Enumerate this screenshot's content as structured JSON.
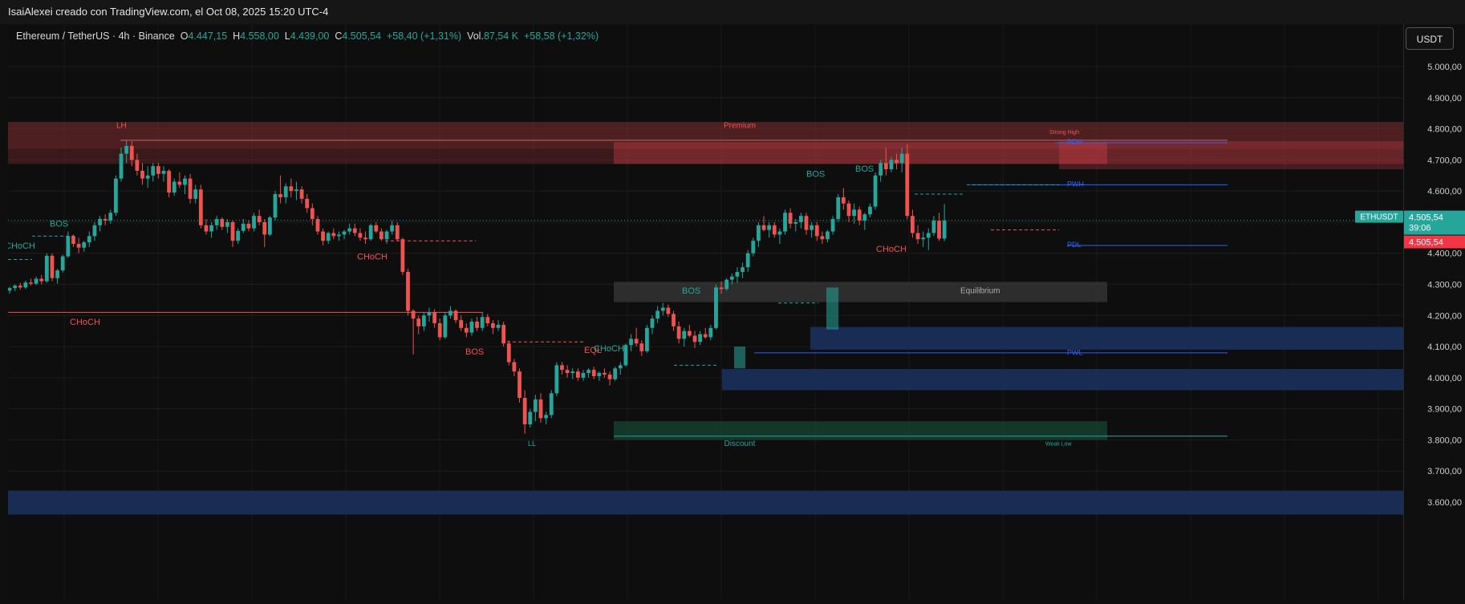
{
  "header": {
    "title": "IsaiAlexei creado con TradingView.com, el Oct 08, 2025 15:20 UTC-4"
  },
  "legend": {
    "symbol": "Ethereum / TetherUS · 4h · Binance",
    "o_label": "O",
    "o_value": "4.447,15",
    "h_label": "H",
    "h_value": "4.558,00",
    "l_label": "L",
    "l_value": "4.439,00",
    "c_label": "C",
    "c_value": "4.505,54",
    "change": "+58,40 (+1,31%)",
    "vol_label": "Vol.",
    "vol_value": "87,54 K",
    "vol_change": "+58,58 (+1,32%)"
  },
  "currency_button": "USDT",
  "last_price": {
    "ticker": "ETHUSDT",
    "price": "4.505,54",
    "countdown": "39:06",
    "price_red": "4.505,54"
  },
  "colors": {
    "up": "#26a69a",
    "down": "#ef5350",
    "premium_zone": "#5c2426",
    "discount_zone": "#10352a",
    "equilibrium_zone": "#2b2b2b",
    "blue_zone": "#16264a",
    "blue_line": "#2962ff"
  },
  "chart_data": {
    "type": "candlestick",
    "symbol": "ETHUSDT",
    "timeframe": "4h",
    "y_axis": {
      "ticks": [
        5000,
        4900,
        4800,
        4700,
        4600,
        4500,
        4400,
        4300,
        4200,
        4100,
        4000,
        3900,
        3800,
        3700,
        3600
      ],
      "tick_labels": [
        "5.000,00",
        "4.900,00",
        "4.800,00",
        "4.700,00",
        "4.600,00",
        "4.500,00",
        "4.400,00",
        "4.300,00",
        "4.200,00",
        "4.100,00",
        "4.000,00",
        "3.900,00",
        "3.800,00",
        "3.700,00",
        "3.600,00"
      ],
      "range": [
        3575,
        5080
      ]
    },
    "candles": [
      [
        4280,
        4292,
        4270,
        4288
      ],
      [
        4288,
        4300,
        4278,
        4296
      ],
      [
        4296,
        4305,
        4283,
        4290
      ],
      [
        4290,
        4312,
        4285,
        4306
      ],
      [
        4306,
        4318,
        4296,
        4302
      ],
      [
        4302,
        4325,
        4298,
        4318
      ],
      [
        4318,
        4330,
        4300,
        4310
      ],
      [
        4310,
        4400,
        4305,
        4392
      ],
      [
        4392,
        4400,
        4310,
        4320
      ],
      [
        4320,
        4350,
        4302,
        4345
      ],
      [
        4345,
        4395,
        4338,
        4390
      ],
      [
        4390,
        4470,
        4385,
        4455
      ],
      [
        4455,
        4460,
        4420,
        4430
      ],
      [
        4430,
        4450,
        4400,
        4418
      ],
      [
        4418,
        4440,
        4405,
        4435
      ],
      [
        4435,
        4470,
        4420,
        4455
      ],
      [
        4455,
        4500,
        4440,
        4490
      ],
      [
        4490,
        4520,
        4470,
        4510
      ],
      [
        4510,
        4525,
        4490,
        4505
      ],
      [
        4505,
        4540,
        4495,
        4530
      ],
      [
        4530,
        4650,
        4520,
        4640
      ],
      [
        4640,
        4740,
        4630,
        4720
      ],
      [
        4720,
        4763,
        4690,
        4745
      ],
      [
        4745,
        4760,
        4680,
        4700
      ],
      [
        4700,
        4720,
        4650,
        4665
      ],
      [
        4665,
        4690,
        4620,
        4640
      ],
      [
        4640,
        4680,
        4610,
        4650
      ],
      [
        4650,
        4690,
        4630,
        4680
      ],
      [
        4680,
        4690,
        4640,
        4655
      ],
      [
        4655,
        4680,
        4630,
        4665
      ],
      [
        4665,
        4670,
        4580,
        4595
      ],
      [
        4595,
        4640,
        4585,
        4630
      ],
      [
        4630,
        4660,
        4610,
        4620
      ],
      [
        4620,
        4650,
        4590,
        4640
      ],
      [
        4640,
        4655,
        4560,
        4575
      ],
      [
        4575,
        4620,
        4560,
        4605
      ],
      [
        4605,
        4620,
        4480,
        4490
      ],
      [
        4490,
        4510,
        4460,
        4470
      ],
      [
        4470,
        4500,
        4450,
        4490
      ],
      [
        4490,
        4520,
        4475,
        4510
      ],
      [
        4510,
        4515,
        4475,
        4485
      ],
      [
        4485,
        4510,
        4465,
        4500
      ],
      [
        4500,
        4505,
        4420,
        4440
      ],
      [
        4440,
        4480,
        4430,
        4472
      ],
      [
        4472,
        4510,
        4465,
        4495
      ],
      [
        4495,
        4505,
        4470,
        4480
      ],
      [
        4480,
        4530,
        4470,
        4520
      ],
      [
        4520,
        4540,
        4490,
        4500
      ],
      [
        4500,
        4510,
        4420,
        4460
      ],
      [
        4460,
        4520,
        4455,
        4515
      ],
      [
        4515,
        4600,
        4505,
        4590
      ],
      [
        4590,
        4650,
        4560,
        4580
      ],
      [
        4580,
        4625,
        4560,
        4615
      ],
      [
        4615,
        4640,
        4580,
        4600
      ],
      [
        4600,
        4630,
        4570,
        4605
      ],
      [
        4605,
        4615,
        4560,
        4575
      ],
      [
        4575,
        4590,
        4530,
        4545
      ],
      [
        4545,
        4560,
        4490,
        4510
      ],
      [
        4510,
        4520,
        4460,
        4470
      ],
      [
        4470,
        4480,
        4425,
        4440
      ],
      [
        4440,
        4470,
        4430,
        4465
      ],
      [
        4465,
        4480,
        4445,
        4455
      ],
      [
        4455,
        4470,
        4440,
        4460
      ],
      [
        4460,
        4475,
        4445,
        4470
      ],
      [
        4470,
        4495,
        4460,
        4480
      ],
      [
        4480,
        4495,
        4455,
        4465
      ],
      [
        4465,
        4480,
        4440,
        4450
      ],
      [
        4450,
        4470,
        4430,
        4445
      ],
      [
        4445,
        4495,
        4440,
        4490
      ],
      [
        4490,
        4500,
        4465,
        4470
      ],
      [
        4470,
        4480,
        4440,
        4445
      ],
      [
        4445,
        4475,
        4430,
        4470
      ],
      [
        4470,
        4505,
        4460,
        4490
      ],
      [
        4490,
        4500,
        4440,
        4445
      ],
      [
        4445,
        4450,
        4330,
        4340
      ],
      [
        4340,
        4350,
        4200,
        4215
      ],
      [
        4215,
        4220,
        4075,
        4190
      ],
      [
        4190,
        4200,
        4140,
        4165
      ],
      [
        4165,
        4210,
        4150,
        4200
      ],
      [
        4200,
        4225,
        4180,
        4210
      ],
      [
        4210,
        4220,
        4160,
        4175
      ],
      [
        4175,
        4190,
        4120,
        4130
      ],
      [
        4130,
        4210,
        4125,
        4200
      ],
      [
        4200,
        4230,
        4190,
        4215
      ],
      [
        4215,
        4220,
        4175,
        4185
      ],
      [
        4185,
        4200,
        4150,
        4160
      ],
      [
        4160,
        4175,
        4130,
        4145
      ],
      [
        4145,
        4190,
        4135,
        4180
      ],
      [
        4180,
        4195,
        4150,
        4160
      ],
      [
        4160,
        4210,
        4150,
        4195
      ],
      [
        4195,
        4205,
        4165,
        4175
      ],
      [
        4175,
        4185,
        4140,
        4160
      ],
      [
        4160,
        4185,
        4150,
        4170
      ],
      [
        4170,
        4180,
        4100,
        4110
      ],
      [
        4110,
        4120,
        4040,
        4050
      ],
      [
        4050,
        4060,
        4005,
        4020
      ],
      [
        4020,
        4030,
        3920,
        3935
      ],
      [
        3935,
        3960,
        3820,
        3850
      ],
      [
        3850,
        3900,
        3840,
        3890
      ],
      [
        3890,
        3945,
        3860,
        3930
      ],
      [
        3930,
        3950,
        3855,
        3870
      ],
      [
        3870,
        3890,
        3850,
        3880
      ],
      [
        3880,
        3960,
        3870,
        3950
      ],
      [
        3950,
        4050,
        3940,
        4040
      ],
      [
        4040,
        4050,
        4010,
        4025
      ],
      [
        4025,
        4040,
        4000,
        4015
      ],
      [
        4015,
        4030,
        3995,
        4020
      ],
      [
        4020,
        4030,
        3990,
        4000
      ],
      [
        4000,
        4025,
        3990,
        4015
      ],
      [
        4015,
        4030,
        4000,
        4025
      ],
      [
        4025,
        4035,
        3995,
        4005
      ],
      [
        4005,
        4020,
        3990,
        4015
      ],
      [
        4015,
        4030,
        4000,
        4010
      ],
      [
        4010,
        4020,
        3975,
        3995
      ],
      [
        3995,
        4035,
        3990,
        4030
      ],
      [
        4030,
        4050,
        4010,
        4040
      ],
      [
        4040,
        4110,
        4035,
        4105
      ],
      [
        4105,
        4140,
        4085,
        4125
      ],
      [
        4125,
        4160,
        4100,
        4110
      ],
      [
        4110,
        4120,
        4070,
        4085
      ],
      [
        4085,
        4170,
        4080,
        4160
      ],
      [
        4160,
        4200,
        4140,
        4190
      ],
      [
        4190,
        4230,
        4175,
        4215
      ],
      [
        4215,
        4240,
        4200,
        4225
      ],
      [
        4225,
        4235,
        4195,
        4205
      ],
      [
        4205,
        4215,
        4150,
        4165
      ],
      [
        4165,
        4180,
        4110,
        4125
      ],
      [
        4125,
        4160,
        4100,
        4150
      ],
      [
        4150,
        4170,
        4130,
        4135
      ],
      [
        4135,
        4150,
        4095,
        4115
      ],
      [
        4115,
        4150,
        4105,
        4140
      ],
      [
        4140,
        4160,
        4125,
        4130
      ],
      [
        4130,
        4170,
        4120,
        4160
      ],
      [
        4160,
        4300,
        4155,
        4290
      ],
      [
        4290,
        4310,
        4270,
        4285
      ],
      [
        4285,
        4320,
        4280,
        4315
      ],
      [
        4315,
        4335,
        4300,
        4325
      ],
      [
        4325,
        4355,
        4305,
        4340
      ],
      [
        4340,
        4370,
        4320,
        4355
      ],
      [
        4355,
        4410,
        4340,
        4400
      ],
      [
        4400,
        4450,
        4390,
        4440
      ],
      [
        4440,
        4500,
        4420,
        4490
      ],
      [
        4490,
        4520,
        4470,
        4475
      ],
      [
        4475,
        4500,
        4450,
        4490
      ],
      [
        4490,
        4500,
        4450,
        4460
      ],
      [
        4460,
        4480,
        4430,
        4470
      ],
      [
        4470,
        4540,
        4460,
        4530
      ],
      [
        4530,
        4545,
        4480,
        4495
      ],
      [
        4495,
        4510,
        4470,
        4500
      ],
      [
        4500,
        4530,
        4480,
        4520
      ],
      [
        4520,
        4530,
        4460,
        4475
      ],
      [
        4475,
        4500,
        4450,
        4490
      ],
      [
        4490,
        4500,
        4440,
        4455
      ],
      [
        4455,
        4470,
        4430,
        4445
      ],
      [
        4445,
        4475,
        4435,
        4470
      ],
      [
        4470,
        4520,
        4460,
        4510
      ],
      [
        4510,
        4590,
        4500,
        4580
      ],
      [
        4580,
        4610,
        4540,
        4560
      ],
      [
        4560,
        4570,
        4500,
        4520
      ],
      [
        4520,
        4560,
        4495,
        4540
      ],
      [
        4540,
        4550,
        4490,
        4505
      ],
      [
        4505,
        4530,
        4475,
        4525
      ],
      [
        4525,
        4560,
        4515,
        4550
      ],
      [
        4550,
        4660,
        4540,
        4650
      ],
      [
        4650,
        4700,
        4630,
        4690
      ],
      [
        4690,
        4740,
        4650,
        4670
      ],
      [
        4670,
        4710,
        4660,
        4700
      ],
      [
        4700,
        4720,
        4670,
        4690
      ],
      [
        4690,
        4740,
        4660,
        4720
      ],
      [
        4720,
        4750,
        4510,
        4520
      ],
      [
        4520,
        4540,
        4450,
        4465
      ],
      [
        4465,
        4490,
        4430,
        4445
      ],
      [
        4445,
        4470,
        4420,
        4450
      ],
      [
        4450,
        4480,
        4410,
        4465
      ],
      [
        4465,
        4520,
        4455,
        4505
      ],
      [
        4505,
        4530,
        4440,
        4447
      ],
      [
        4447,
        4558,
        4439,
        4505
      ]
    ],
    "annotations": {
      "labels": [
        "LH",
        "Premium",
        "Strong High",
        "PDH",
        "PWH",
        "PDL",
        "PWL",
        "Equilibrium",
        "Discount",
        "LL",
        "Weak Low",
        "BOS",
        "BOS",
        "BOS",
        "BOS",
        "BOS",
        "CHoCH",
        "CHoCH",
        "CHoCH",
        "CHoCH",
        "CHoCH",
        "EQL"
      ],
      "levels": {
        "PDH": 4755,
        "PWH": 4620,
        "PDL": 4425,
        "PWL": 4080,
        "Strong High": 4763,
        "Weak Low": 3812
      }
    },
    "grid": true
  }
}
